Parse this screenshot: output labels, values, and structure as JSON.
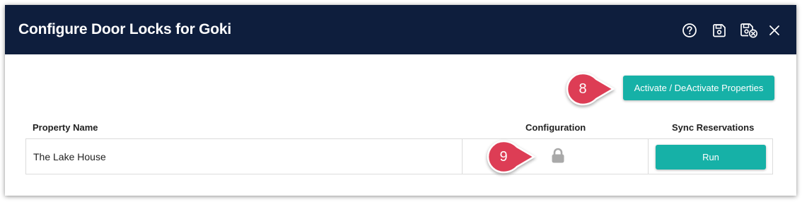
{
  "dialog": {
    "title": "Configure Door Locks for Goki"
  },
  "header_icons": [
    {
      "name": "help-icon"
    },
    {
      "name": "save-icon"
    },
    {
      "name": "save-close-icon"
    },
    {
      "name": "close-icon"
    }
  ],
  "toolbar": {
    "activate_label": "Activate / DeActivate Properties"
  },
  "table": {
    "columns": [
      "Property Name",
      "Configuration",
      "Sync Reservations"
    ],
    "rows": [
      {
        "property_name": "The Lake House",
        "configuration_icon": "lock-icon",
        "sync_label": "Run"
      }
    ]
  },
  "callouts": [
    "8",
    "9"
  ],
  "colors": {
    "header_bg": "#0e1e3d",
    "accent": "#16b1a7",
    "callout": "#dd3d55",
    "lock": "#a9a9a9"
  }
}
